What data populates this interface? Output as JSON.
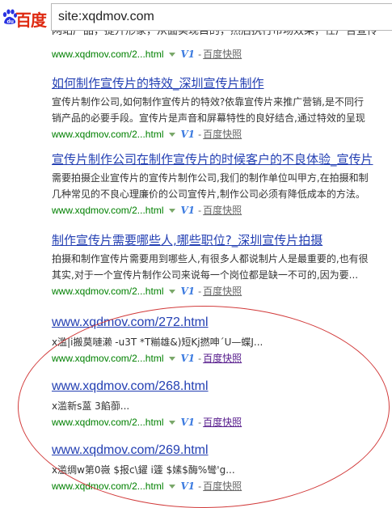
{
  "search": {
    "query": "site:xqdmov.com"
  },
  "logo": {
    "text": "百度"
  },
  "partial_line": "网站产品，提升形象，从面实现目的，然后执行市场效果，任广告宣传",
  "results": [
    {
      "title": "",
      "abstract": [],
      "url": "www.xqdmov.com/2...html",
      "v1": "V1",
      "sep": "-",
      "snapshot": "百度快照"
    },
    {
      "title": "如何制作宣传片的特效_深圳宣传片制作",
      "abstract": [
        "宣传片制作公司,如何制作宣传片的特效?依靠宣传片来推广营销,是不同行",
        "销产品的必要手段。宣传片是声音和屏幕特性的良好结合,通过特效的呈现"
      ],
      "url": "www.xqdmov.com/2...html",
      "v1": "V1",
      "sep": "-",
      "snapshot": "百度快照"
    },
    {
      "title": "宣传片制作公司在制作宣传片的时候客户的不良体验_宣传片",
      "abstract": [
        "需要拍摄企业宣传片的宣传片制作公司,我们的制作单位叫甲方,在拍摄和制",
        "几种常见的不良心理廉价的公司宣传片,制作公司必须有降低成本的方法。"
      ],
      "url": "www.xqdmov.com/2...html",
      "v1": "V1",
      "sep": "-",
      "snapshot": "百度快照"
    },
    {
      "title": "制作宣传片需要哪些人,哪些职位?_深圳宣传片拍摄",
      "abstract": [
        "拍摄和制作宣传片需要用到哪些人,有很多人都说制片人是最重要的,也有很",
        "其实,对于一个宣传片制作公司来说每一个岗位都是缺一不可的,因为要..."
      ],
      "url": "www.xqdmov.com/2...html",
      "v1": "V1",
      "sep": "-",
      "snapshot": "百度快照"
    },
    {
      "title": "www.xqdmov.com/272.html",
      "abstract": [
        "x滥|i搬莫嗹濑 -u3T *T糋雄&)短Kj撚呻´U—蝶J..."
      ],
      "url": "www.xqdmov.com/2...html",
      "v1": "V1",
      "sep": "-",
      "snapshot": "百度快照"
    },
    {
      "title": "www.xqdmov.com/268.html",
      "abstract": [
        "x滥新s蒕 3餡蓹..."
      ],
      "url": "www.xqdmov.com/2...html",
      "v1": "V1",
      "sep": "-",
      "snapshot": "百度快照"
    },
    {
      "title": "www.xqdmov.com/269.html",
      "abstract": [
        "x滥绸w第0嶶 $报c\\鑃 i籧 $嫊$酶%彎'g..."
      ],
      "url": "www.xqdmov.com/2...html",
      "v1": "V1",
      "sep": "-",
      "snapshot": "百度快照"
    }
  ],
  "colors": {
    "link": "#2440b3",
    "url_green": "#008000",
    "annotation_circle": "#d23c3c",
    "logo_red": "#de2910",
    "logo_blue": "#2932e1"
  }
}
